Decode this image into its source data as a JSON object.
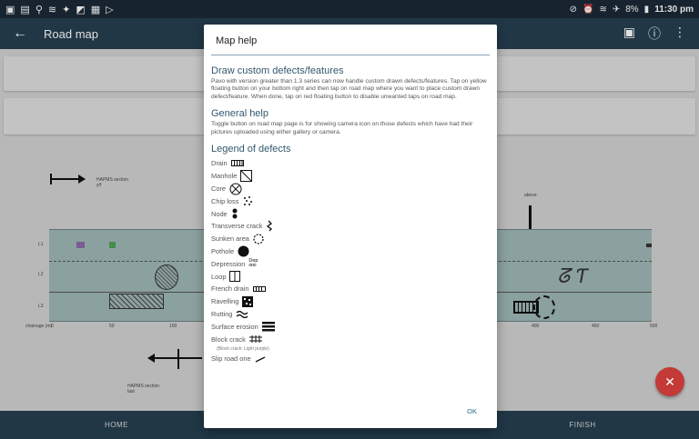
{
  "statusbar": {
    "battery": "8%",
    "time": "11:30 pm"
  },
  "appbar": {
    "title": "Road map"
  },
  "background": {
    "chainage_label": "chainage (m)",
    "chainage_ticks": [
      "0",
      "50",
      "100",
      "400",
      "450",
      "500"
    ],
    "lane_labels": [
      "L1",
      "L2",
      "L3"
    ],
    "section_label_top": "HAPMS section",
    "section_label_top_sub": "y/f",
    "section_label_bottom": "HAPMS section",
    "section_label_bottom_sub": "last",
    "above_label": "above"
  },
  "bottombar": {
    "home": "HOME",
    "finish": "FINISH"
  },
  "dialog": {
    "title": "Map help",
    "sections": [
      {
        "heading": "Draw custom defects/features",
        "text": "Pavo with version greater than 1.3 series can now handle custom drawn defects/features. Tap on yellow floating button on your bottom right and then tap on road map where you want to place custom drawn defect/feature. When done, tap on red floating button to disable unwanted taps on road map."
      },
      {
        "heading": "General help",
        "text": "Toggle button on road map page is for showing camera icon on those defects which have had their pictures uploaded using either gallery or camera."
      }
    ],
    "legend_heading": "Legend of defects",
    "legend": [
      {
        "label": "Drain",
        "icon": "drain-icon"
      },
      {
        "label": "Manhole",
        "icon": "manhole-icon"
      },
      {
        "label": "Core",
        "icon": "core-icon"
      },
      {
        "label": "Chip loss",
        "icon": "chip-loss-icon"
      },
      {
        "label": "Node",
        "icon": "node-icon"
      },
      {
        "label": "Transverse crack",
        "icon": "transverse-crack-icon"
      },
      {
        "label": "Sunken area",
        "icon": "sunken-area-icon"
      },
      {
        "label": "Pothole",
        "icon": "pothole-icon"
      },
      {
        "label": "Depression",
        "icon": "depression-icon"
      },
      {
        "label": "Loop",
        "icon": "loop-icon"
      },
      {
        "label": "French drain",
        "icon": "french-drain-icon"
      },
      {
        "label": "Ravelling",
        "icon": "ravelling-icon"
      },
      {
        "label": "Rutting",
        "icon": "rutting-icon"
      },
      {
        "label": "Surface erosion",
        "icon": "surface-erosion-icon"
      },
      {
        "label": "Block crack",
        "icon": "block-crack-icon"
      },
      {
        "label": "Slip road one",
        "icon": "slip-road-icon"
      }
    ],
    "block_crack_note": "(Block crack: Light purple)",
    "depression_sym_text": "Dep",
    "ok_label": "OK"
  },
  "colors": {
    "appbar": "#263f50",
    "statusbar": "#1b2a36",
    "fab": "#c33a36",
    "heading": "#33586e",
    "road": "#9fb8b6"
  }
}
